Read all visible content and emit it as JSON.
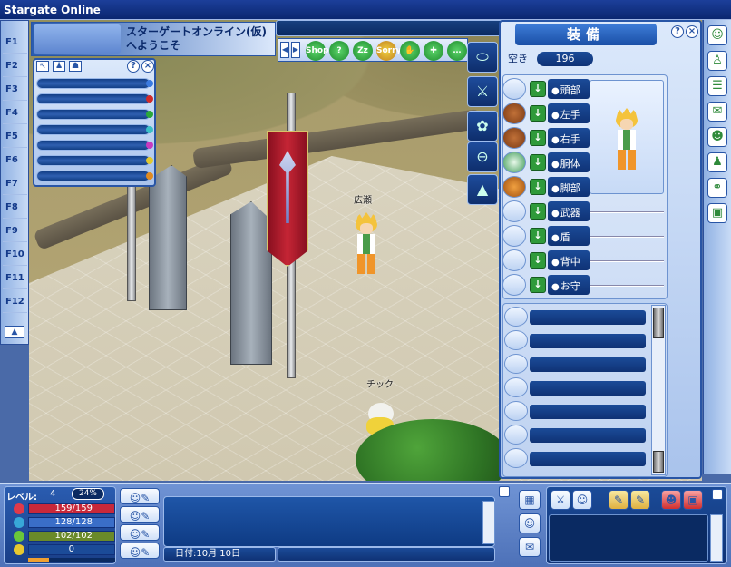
{
  "window": {
    "title": "Stargate Online"
  },
  "welcome": {
    "text": "スターゲートオンライン(仮)へようこそ"
  },
  "fkeys": [
    "F1",
    "F2",
    "F3",
    "F4",
    "F5",
    "F6",
    "F7",
    "F8",
    "F9",
    "F10",
    "F11",
    "F12"
  ],
  "equip": {
    "title": "装備",
    "space_label": "空き",
    "space_value": "196",
    "slots": [
      "頭部",
      "左手",
      "右手",
      "胴体",
      "脚部",
      "武器",
      "盾",
      "背中",
      "お守"
    ]
  },
  "world": {
    "player_name": "広瀬",
    "npc_name": "チック"
  },
  "toolbar": {
    "shop": "Shop",
    "sorry": "Sorry"
  },
  "status": {
    "level_label": "レベル:",
    "level": "4",
    "exp": "24%",
    "hp": "159/159",
    "mp": "128/128",
    "sp": "102/102",
    "money": "0"
  },
  "chat": {
    "date": "日付:10月 10日"
  },
  "colors": {
    "hp": "#c8283a",
    "mp": "#3a6ec8",
    "sp": "#6a8a2a",
    "frame": "#2855a6"
  }
}
